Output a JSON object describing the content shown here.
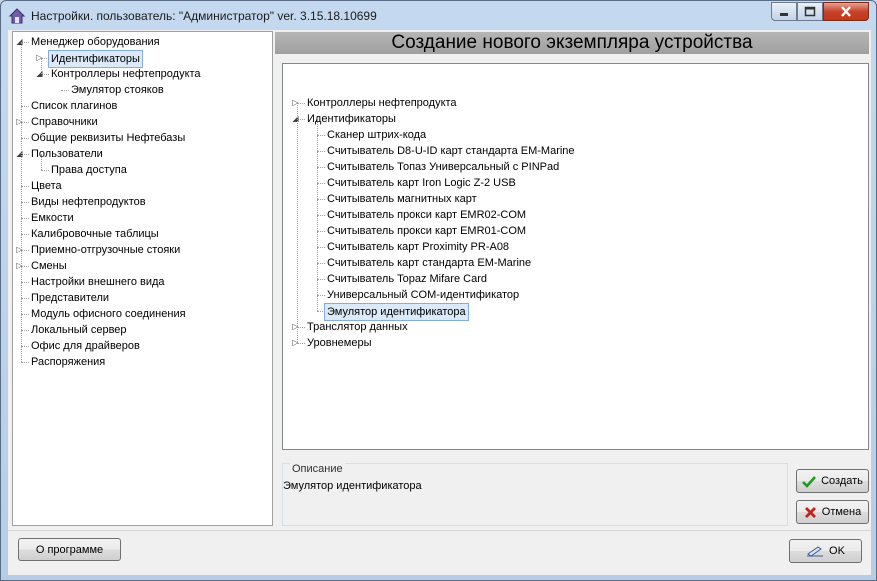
{
  "window": {
    "title": "Настройки. пользователь: \"Администратор\" ver. 3.15.18.10699"
  },
  "left_tree": [
    {
      "label": "Менеджер оборудования",
      "expander": "open"
    },
    {
      "label": "Идентификаторы",
      "expander": "collapsed",
      "selected": true
    },
    {
      "label": "Контроллеры нефтепродукта",
      "expander": "open"
    },
    {
      "label": "Эмулятор стояков"
    },
    {
      "label": "Список плагинов"
    },
    {
      "label": "Справочники",
      "expander": "collapsed"
    },
    {
      "label": "Общие реквизиты Нефтебазы"
    },
    {
      "label": "Пользователи",
      "expander": "open"
    },
    {
      "label": "Права доступа"
    },
    {
      "label": "Цвета"
    },
    {
      "label": "Виды нефтепродуктов"
    },
    {
      "label": "Емкости"
    },
    {
      "label": "Калибровочные таблицы"
    },
    {
      "label": "Приемно-отгрузочные стояки",
      "expander": "collapsed"
    },
    {
      "label": "Смены",
      "expander": "collapsed"
    },
    {
      "label": "Настройки внешнего вида"
    },
    {
      "label": "Представители"
    },
    {
      "label": "Модуль офисного соединения"
    },
    {
      "label": "Локальный сервер"
    },
    {
      "label": "Офис для драйверов"
    },
    {
      "label": "Распоряжения"
    }
  ],
  "header_title": "Создание нового экземпляра устройства",
  "device_tree": [
    {
      "label": "Контроллеры нефтепродукта",
      "expander": "collapsed"
    },
    {
      "label": "Идентификаторы",
      "expander": "open"
    },
    {
      "label": "Сканер штрих-кода"
    },
    {
      "label": "Считыватель D8-U-ID карт стандарта EM-Marine"
    },
    {
      "label": "Считыватель Топаз Универсальный с PINPad"
    },
    {
      "label": "Считыватель карт Iron Logic Z-2 USB"
    },
    {
      "label": "Считыватель магнитных карт"
    },
    {
      "label": "Считыватель прокси карт EMR02-COM"
    },
    {
      "label": "Считыватель прокси карт EMR01-COM"
    },
    {
      "label": "Считыватель карт Proximity PR-A08"
    },
    {
      "label": "Считыватель карт стандарта EM-Marine"
    },
    {
      "label": "Считыватель Topaz Mifare Card"
    },
    {
      "label": "Универсальный COM-идентификатор"
    },
    {
      "label": "Эмулятор идентификатора",
      "selected": true
    },
    {
      "label": "Транслятор данных",
      "expander": "collapsed"
    },
    {
      "label": "Уровнемеры",
      "expander": "collapsed"
    }
  ],
  "description": {
    "legend": "Описание",
    "text": "Эмулятор идентификатора"
  },
  "buttons": {
    "create": "Создать",
    "cancel": "Отмена",
    "about": "О программе",
    "ok": "OK"
  }
}
